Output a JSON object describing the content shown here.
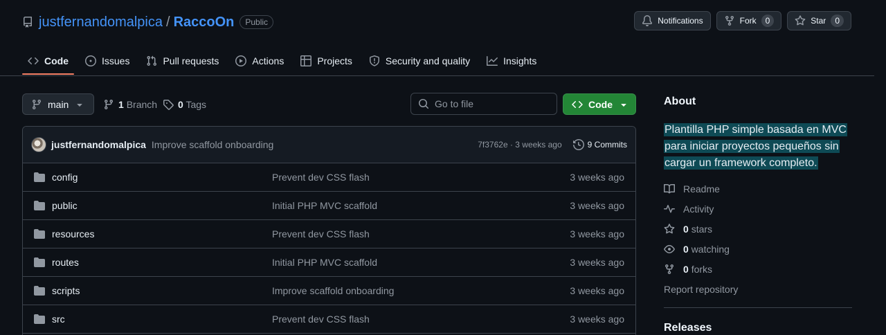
{
  "repo": {
    "owner": "justfernandomalpica",
    "separator": "/",
    "name": "RaccoOn",
    "visibility": "Public"
  },
  "header_actions": {
    "notifications_label": "Notifications",
    "fork_label": "Fork",
    "fork_count": "0",
    "star_label": "Star",
    "star_count": "0"
  },
  "tabs": [
    {
      "label": "Code",
      "icon": "code-icon",
      "active": true
    },
    {
      "label": "Issues",
      "icon": "issue-icon"
    },
    {
      "label": "Pull requests",
      "icon": "pull-request-icon"
    },
    {
      "label": "Actions",
      "icon": "play-icon"
    },
    {
      "label": "Projects",
      "icon": "table-icon"
    },
    {
      "label": "Security and quality",
      "icon": "shield-icon"
    },
    {
      "label": "Insights",
      "icon": "graph-icon"
    }
  ],
  "branch_bar": {
    "branch": "main",
    "branch_count": "1",
    "branch_label": "Branch",
    "tag_count": "0",
    "tag_label": "Tags",
    "goto_placeholder": "Go to file",
    "code_button": "Code"
  },
  "latest_commit": {
    "author": "justfernandomalpica",
    "message": "Improve scaffold onboarding",
    "hash_time": "7f3762e · 3 weeks ago",
    "commits_label": "9 Commits"
  },
  "files": [
    {
      "name": "config",
      "message": "Prevent dev CSS flash",
      "date": "3 weeks ago"
    },
    {
      "name": "public",
      "message": "Initial PHP MVC scaffold",
      "date": "3 weeks ago"
    },
    {
      "name": "resources",
      "message": "Prevent dev CSS flash",
      "date": "3 weeks ago"
    },
    {
      "name": "routes",
      "message": "Initial PHP MVC scaffold",
      "date": "3 weeks ago"
    },
    {
      "name": "scripts",
      "message": "Improve scaffold onboarding",
      "date": "3 weeks ago"
    },
    {
      "name": "src",
      "message": "Prevent dev CSS flash",
      "date": "3 weeks ago"
    }
  ],
  "about": {
    "title": "About",
    "description": "Plantilla PHP simple basada en MVC para iniciar proyectos pequeños sin cargar un framework completo.",
    "readme": "Readme",
    "activity": "Activity",
    "stars_count": "0",
    "stars_label": "stars",
    "watching_count": "0",
    "watching_label": "watching",
    "forks_count": "0",
    "forks_label": "forks",
    "report": "Report repository"
  },
  "releases": {
    "title": "Releases"
  },
  "colors": {
    "background": "#0d1117",
    "link": "#4493f8",
    "accent_underline": "#f78166",
    "code_button": "#238636",
    "description_highlight": "#0e4a55"
  }
}
